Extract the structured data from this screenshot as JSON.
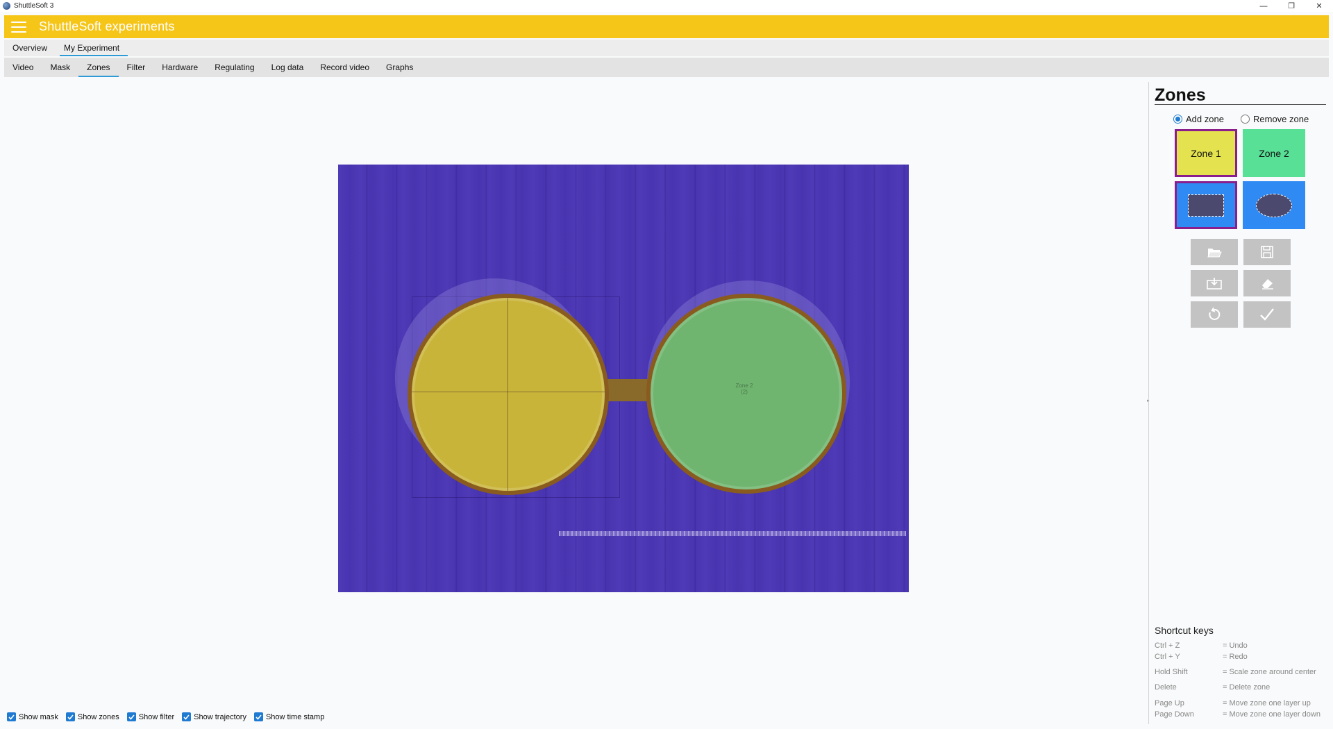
{
  "window": {
    "title": "ShuttleSoft 3",
    "minimize": "—",
    "restore": "❐",
    "close": "✕"
  },
  "app": {
    "title": "ShuttleSoft experiments",
    "accent_color": "#f5c518",
    "tab_underline_color": "#2e9bd6"
  },
  "top_tabs": [
    {
      "label": "Overview",
      "active": false
    },
    {
      "label": "My Experiment",
      "active": true
    }
  ],
  "sub_tabs": [
    {
      "label": "Video",
      "active": false
    },
    {
      "label": "Mask",
      "active": false
    },
    {
      "label": "Zones",
      "active": true
    },
    {
      "label": "Filter",
      "active": false
    },
    {
      "label": "Hardware",
      "active": false
    },
    {
      "label": "Regulating",
      "active": false
    },
    {
      "label": "Log data",
      "active": false
    },
    {
      "label": "Record video",
      "active": false
    },
    {
      "label": "Graphs",
      "active": false
    }
  ],
  "video": {
    "zone2_overlay_label": "Zone 2",
    "zone2_overlay_sub": "(2)"
  },
  "panel": {
    "title": "Zones",
    "mode_options": [
      {
        "label": "Add zone",
        "selected": true
      },
      {
        "label": "Remove zone",
        "selected": false
      }
    ],
    "zone_buttons": [
      {
        "label": "Zone 1",
        "color": "#e4e24e",
        "selected": true
      },
      {
        "label": "Zone 2",
        "color": "#58e096",
        "selected": false
      }
    ],
    "shape_buttons": [
      {
        "icon": "rectangle-shape-icon",
        "selected": true
      },
      {
        "icon": "ellipse-shape-icon",
        "selected": false
      }
    ],
    "tools": [
      {
        "icon": "open-folder-icon"
      },
      {
        "icon": "save-icon"
      },
      {
        "icon": "import-icon"
      },
      {
        "icon": "eraser-icon"
      },
      {
        "icon": "reset-icon"
      },
      {
        "icon": "checkmark-icon"
      }
    ]
  },
  "shortcuts": {
    "title": "Shortcut keys",
    "items": [
      {
        "key": "Ctrl + Z",
        "desc": "= Undo"
      },
      {
        "key": "Ctrl + Y",
        "desc": "= Redo"
      },
      {
        "key": "Hold Shift",
        "desc": "= Scale zone around center"
      },
      {
        "key": "Delete",
        "desc": "= Delete zone"
      },
      {
        "key": "Page Up",
        "desc": "= Move zone one layer up"
      },
      {
        "key": "Page Down",
        "desc": "= Move zone one layer down"
      }
    ]
  },
  "checkboxes": [
    {
      "label": "Show mask",
      "checked": true
    },
    {
      "label": "Show zones",
      "checked": true
    },
    {
      "label": "Show filter",
      "checked": true
    },
    {
      "label": "Show trajectory",
      "checked": true
    },
    {
      "label": "Show time stamp",
      "checked": true
    }
  ]
}
